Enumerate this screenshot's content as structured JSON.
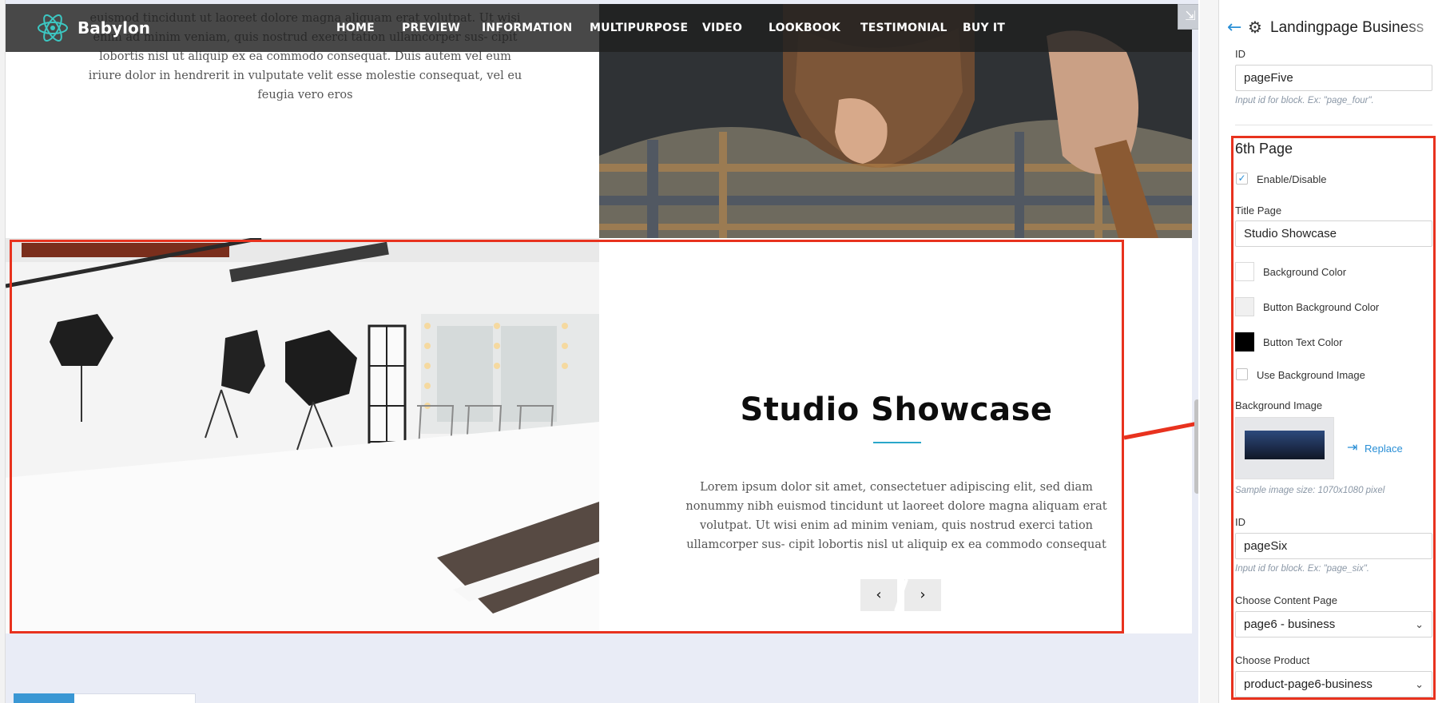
{
  "site": {
    "brand": "Babylon",
    "nav": [
      "HOME",
      "PREVIEW",
      "INFORMATION",
      "MULTIPURPOSE",
      "VIDEO",
      "LOOKBOOK",
      "TESTIMONIAL",
      "BUY IT"
    ],
    "top_paragraph": "euismod tincidunt ut laoreet dolore magna aliquam erat volutpat. Ut wisi enim ad minim veniam, quis nostrud exerci tation ullamcorper sus- cipit lobortis nisl ut aliquip ex ea commodo consequat. Duis autem vel eum iriure dolor in hendrerit in vulputate velit esse molestie consequat, vel eu feugia vero eros",
    "studio": {
      "title": "Studio Showcase",
      "text": "Lorem ipsum dolor sit amet, consectetuer adipiscing elit, sed diam nonummy nibh euismod tincidunt ut laoreet dolore magna aliquam erat volutpat. Ut wisi enim ad minim veniam, quis nostrud exerci tation ullamcorper sus- cipit lobortis nisl ut aliquip ex ea commodo consequat",
      "prev": "‹",
      "next": "›"
    }
  },
  "panel": {
    "title": "Landingpage Business",
    "back_icon": "arrow-left-icon",
    "settings_icon": "gear-icon",
    "prev_id_label": "ID",
    "prev_id_value": "pageFive",
    "prev_id_hint": "Input id for block. Ex: \"page_four\".",
    "section_title": "6th Page",
    "enable_label": "Enable/Disable",
    "enable_checked": true,
    "title_page_label": "Title Page",
    "title_page_value": "Studio Showcase",
    "bg_color_label": "Background Color",
    "bg_color": "#ffffff",
    "btn_bg_color_label": "Button Background Color",
    "btn_bg_color": "#f0f0f0",
    "btn_text_color_label": "Button Text Color",
    "btn_text_color": "#000000",
    "use_bg_image_label": "Use Background Image",
    "use_bg_image_checked": false,
    "bg_image_label": "Background Image",
    "replace_label": "Replace",
    "bg_image_hint": "Sample image size: 1070x1080 pixel",
    "id_label": "ID",
    "id_value": "pageSix",
    "id_hint": "Input id for block. Ex: \"page_six\".",
    "content_page_label": "Choose Content Page",
    "content_page_value": "page6 - business",
    "product_label": "Choose Product",
    "product_value": "product-page6-business"
  },
  "colors": {
    "accent": "#2aa7c9",
    "link": "#2a8fd6",
    "highlight": "#e8321e"
  }
}
